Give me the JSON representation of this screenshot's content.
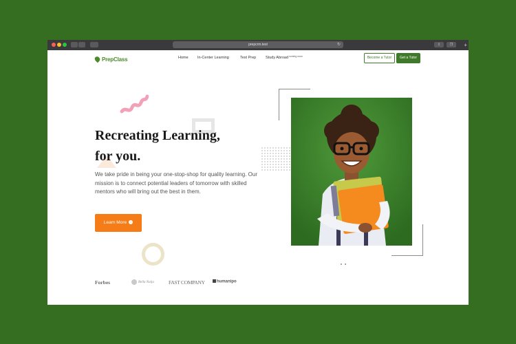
{
  "browser": {
    "url": "prepcrm.test"
  },
  "logo": {
    "text": "PrepClass"
  },
  "nav": {
    "items": [
      {
        "label": "Home"
      },
      {
        "label": "In-Center Learning"
      },
      {
        "label": "Test Prep"
      },
      {
        "label": "Study Abroad"
      }
    ],
    "badge": "coming soon"
  },
  "header_actions": {
    "become_tutor": "Become a Tutor",
    "get_tutor": "Get a Tutor"
  },
  "hero": {
    "title_line1": "Recreating Learning,",
    "title_line2": "for you.",
    "description": "We take pride in being your one-stop-shop for quality learning. Our mission is to connect potential leaders of tomorrow with skilled mentors who will bring out the best in them.",
    "cta_label": "Learn More"
  },
  "press_logos": [
    {
      "name": "Forbes"
    },
    {
      "name": "Bella Naija"
    },
    {
      "name": "FAST COMPANY"
    },
    {
      "name": "humanipo"
    }
  ],
  "colors": {
    "page_background": "#356e21",
    "brand_green": "#3f7a2a",
    "cta_orange": "#f57c17"
  }
}
